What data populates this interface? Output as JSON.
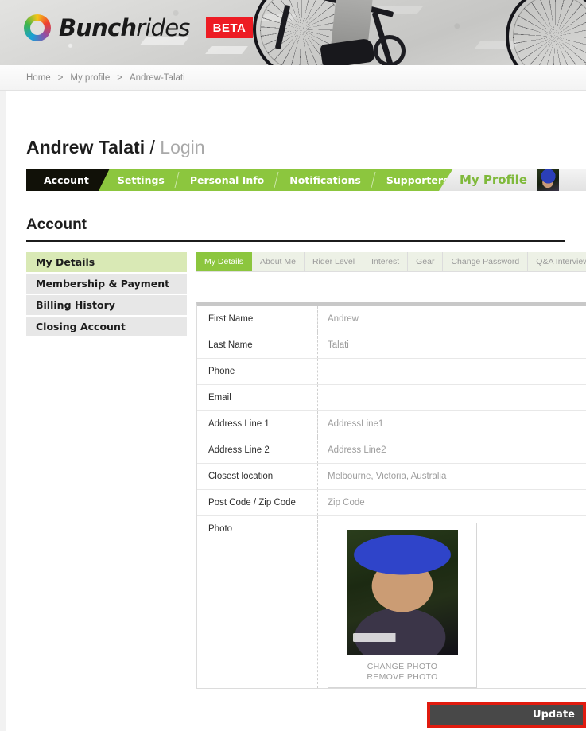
{
  "branding": {
    "logo_text_bold": "Bunch",
    "logo_text_thin": "rides",
    "beta_badge": "BETA",
    "logo_icon": "bunchrides-ring-logo",
    "hero_image": "cyclist-road-bike-photo",
    "accent_green": "#8cc63e",
    "accent_light_green": "#d9e9b5",
    "accent_red": "#ed1c24",
    "annotation_red": "#e01b0f"
  },
  "breadcrumb": {
    "items": [
      "Home",
      "My profile",
      "Andrew-Talati"
    ],
    "separator": ">"
  },
  "header": {
    "user_name": "Andrew Talati",
    "slash": "/",
    "page_context": "Login"
  },
  "main_tabs": {
    "items": [
      {
        "label": "Account",
        "active": true
      },
      {
        "label": "Settings",
        "active": false
      },
      {
        "label": "Personal Info",
        "active": false
      },
      {
        "label": "Notifications",
        "active": false
      },
      {
        "label": "Supporters",
        "active": false
      }
    ],
    "profile_label": "My Profile",
    "avatar": "user-avatar-thumbnail"
  },
  "section": {
    "title": "Account"
  },
  "sidebar": {
    "items": [
      {
        "label": "My Details",
        "active": true
      },
      {
        "label": "Membership & Payment",
        "active": false
      },
      {
        "label": "Billing History",
        "active": false
      },
      {
        "label": "Closing Account",
        "active": false
      }
    ]
  },
  "subtabs": {
    "items": [
      {
        "label": "My Details",
        "active": true
      },
      {
        "label": "About Me",
        "active": false
      },
      {
        "label": "Rider Level",
        "active": false
      },
      {
        "label": "Interest",
        "active": false
      },
      {
        "label": "Gear",
        "active": false
      },
      {
        "label": "Change Password",
        "active": false
      },
      {
        "label": "Q&A Interview",
        "active": false
      }
    ]
  },
  "form": {
    "rows": [
      {
        "label": "First Name",
        "value": "Andrew"
      },
      {
        "label": "Last Name",
        "value": "Talati"
      },
      {
        "label": "Phone",
        "value": ""
      },
      {
        "label": "Email",
        "value": ""
      },
      {
        "label": "Address Line 1",
        "value": "AddressLine1"
      },
      {
        "label": "Address Line 2",
        "value": "Address Line2"
      },
      {
        "label": "Closest location",
        "value": "Melbourne, Victoria, Australia"
      },
      {
        "label": "Post Code / Zip Code",
        "value": "Zip Code"
      }
    ],
    "photo_row": {
      "label": "Photo",
      "image": "profile-photo-cyclist-blue-cap",
      "change_link": "CHANGE PHOTO",
      "remove_link": "REMOVE PHOTO"
    }
  },
  "actions": {
    "update_label": "Update"
  }
}
